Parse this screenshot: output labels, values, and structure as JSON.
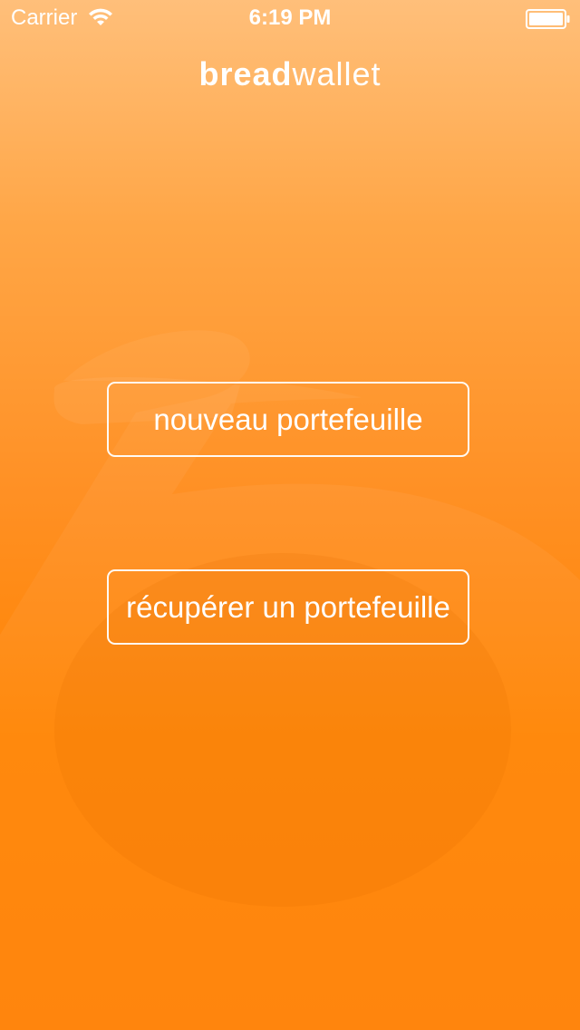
{
  "status_bar": {
    "carrier": "Carrier",
    "time": "6:19 PM",
    "icons": [
      "wifi-icon",
      "battery-icon"
    ]
  },
  "header": {
    "title_bold": "bread",
    "title_light": "wallet"
  },
  "actions": {
    "new_wallet_label": "nouveau portefeuille",
    "recover_wallet_label": "récupérer un portefeuille"
  },
  "colors": {
    "gradient_top": "#ffbf7a",
    "gradient_bottom": "#ff7f00",
    "foreground": "#ffffff"
  }
}
